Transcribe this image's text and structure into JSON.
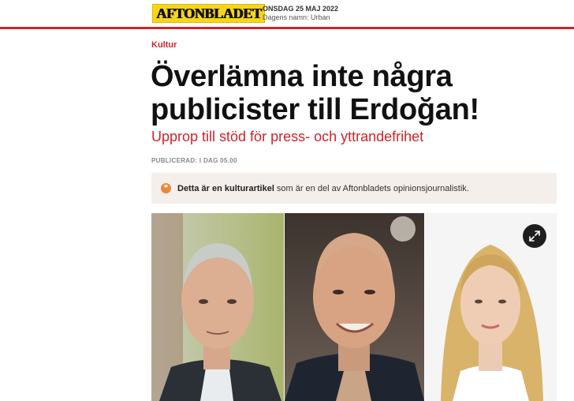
{
  "header": {
    "logo_text": "AFTONBLADET",
    "date": "ONSDAG 25 MAJ 2022",
    "name_day": "Dagens namn: Urban"
  },
  "article": {
    "section": "Kultur",
    "headline": "Överlämna inte några publicister till Erdoğan!",
    "subheadline": "Upprop till stöd för press- och yttrandefrihet",
    "published": "PUBLICERAD: I DAG 05.00"
  },
  "notice": {
    "icon": "quote-icon",
    "bold_text": "Detta är en kulturartikel",
    "text": "som är en del av Aftonbladets opinionsjournalistik."
  },
  "media": {
    "expand_icon": "expand-icon",
    "accent_color": "#d0232a",
    "logo_color": "#f7d51e"
  }
}
